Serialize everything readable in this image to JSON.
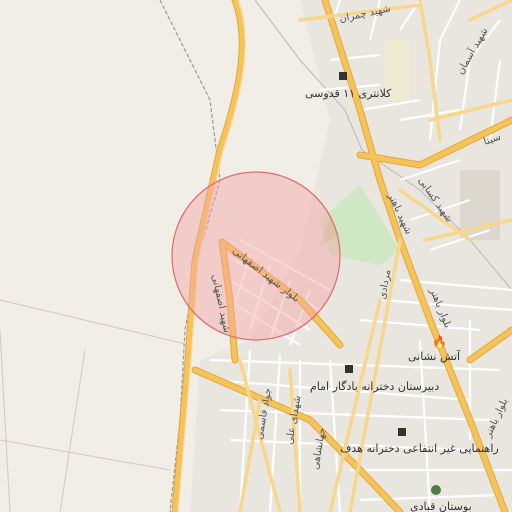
{
  "map": {
    "colors": {
      "background": "#f1ede7",
      "urban": "#e9e6e0",
      "block": "#e2ddd6",
      "major_road": "#f6c35a",
      "major_road_casing": "#e1a93d",
      "minor_road": "#ffffff",
      "park": "#cfe8c4",
      "rail": "#9a9aa0",
      "marker_fill": "#f5a3a3",
      "marker_stroke": "#e26a6a",
      "label": "#333333"
    },
    "marker": {
      "type": "radius-circle"
    },
    "road_labels": [
      "شهید چمران",
      "شهید آسمان",
      "سینا",
      "شهید کسایی",
      "شهید باهنر",
      "بلوار باهنر",
      "بلوار شهید اصفهانی",
      "شهید اصفهانی",
      "مردادی",
      "جواد قاسمی",
      "شهدای علی",
      "جهانشاهی",
      "بلوار باهنر"
    ],
    "pois": [
      {
        "name": "کلانتری ۱۱ قدوسی",
        "icon": "police-station-icon"
      },
      {
        "name": "آتش نشانی",
        "icon": "fire-station-icon"
      },
      {
        "name": "دبیرستان دخترانه یادگار امام",
        "icon": "school-icon"
      },
      {
        "name": "راهنمایی غیر انتفاعی دخترانه هدف",
        "icon": "school-icon"
      },
      {
        "name": "بوستان قبادی",
        "icon": "park-tree-icon"
      }
    ]
  }
}
